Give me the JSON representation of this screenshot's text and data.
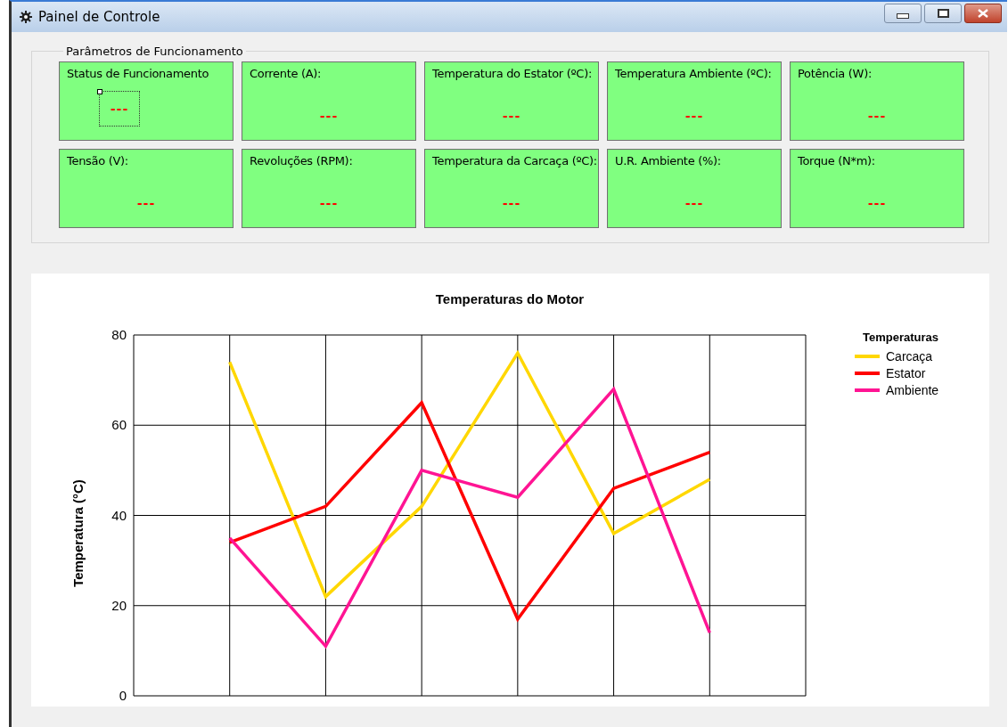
{
  "window": {
    "title": "Painel de Controle"
  },
  "group": {
    "title": "Parâmetros de Funcionamento",
    "tiles": [
      {
        "kind": "status",
        "label": "Status de Funcionamento",
        "value": "---"
      },
      {
        "kind": "reading",
        "label": "Corrente (A):",
        "value": "---"
      },
      {
        "kind": "reading",
        "label": "Temperatura do Estator (ºC):",
        "value": "---"
      },
      {
        "kind": "reading",
        "label": "Temperatura Ambiente (ºC):",
        "value": "---"
      },
      {
        "kind": "reading",
        "label": "Potência (W):",
        "value": "---"
      },
      {
        "kind": "reading",
        "label": "Tensão (V):",
        "value": "---"
      },
      {
        "kind": "reading",
        "label": "Revoluções (RPM):",
        "value": "---"
      },
      {
        "kind": "reading",
        "label": "Temperatura da Carcaça (ºC):",
        "value": "---"
      },
      {
        "kind": "reading",
        "label": "U.R. Ambiente (%):",
        "value": "---"
      },
      {
        "kind": "reading",
        "label": "Torque (N*m):",
        "value": "---"
      }
    ]
  },
  "chart": {
    "chart_data": {
      "type": "line",
      "title": "Temperaturas do Motor",
      "ylabel": "Temperatura (°C)",
      "legend": {
        "title": "Temperaturas"
      },
      "grid": true,
      "ylim": [
        0,
        80
      ],
      "yticks": [
        0,
        20,
        40,
        60,
        80
      ],
      "series": [
        {
          "name": "Carcaça",
          "color": "#ffd700",
          "values": [
            74,
            22,
            42,
            76,
            36,
            48
          ]
        },
        {
          "name": "Estator",
          "color": "#ff0000",
          "values": [
            34,
            42,
            65,
            17,
            46,
            54
          ]
        },
        {
          "name": "Ambiente",
          "color": "#ff1493",
          "values": [
            35,
            11,
            50,
            44,
            68,
            14
          ]
        }
      ]
    }
  }
}
